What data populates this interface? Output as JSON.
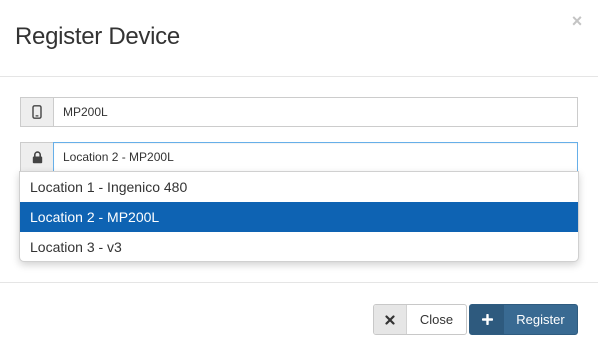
{
  "modal": {
    "title": "Register Device",
    "close_glyph": "×"
  },
  "device_field": {
    "icon": "mobile-phone-icon",
    "value": "MP200L"
  },
  "location_field": {
    "icon": "lock-icon",
    "value": "Location 2 - MP200L"
  },
  "location_dropdown": {
    "options": [
      {
        "label": "Location 1 - Ingenico 480",
        "selected": false
      },
      {
        "label": "Location 2 - MP200L",
        "selected": true
      },
      {
        "label": "Location 3 - v3",
        "selected": false
      }
    ]
  },
  "footer": {
    "close_button": {
      "icon": "times-icon",
      "label": "Close"
    },
    "register_button": {
      "icon": "plus-icon",
      "label": "Register"
    }
  },
  "colors": {
    "selected_option_bg": "#0e63b3",
    "register_button_bg": "#396a92",
    "focus_border": "#66afe9"
  }
}
